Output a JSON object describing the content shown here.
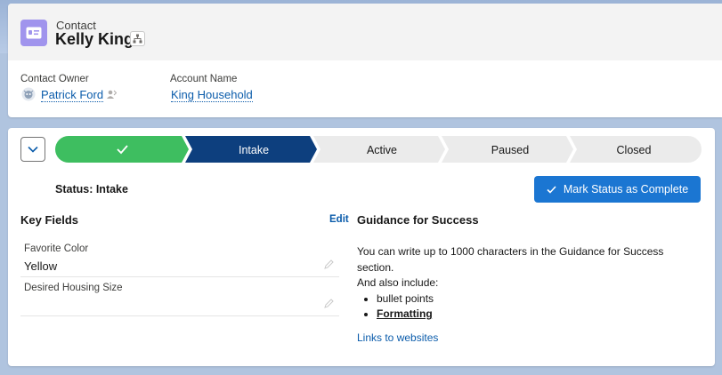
{
  "record": {
    "object_label": "Contact",
    "name": "Kelly King",
    "object_icon": "contact-card-icon",
    "accent_color": "#a094ed"
  },
  "highlights": {
    "owner_label": "Contact Owner",
    "owner_name": "Patrick Ford",
    "account_label": "Account Name",
    "account_name": "King Household"
  },
  "path": {
    "stages": [
      {
        "label": "",
        "state": "complete"
      },
      {
        "label": "Intake",
        "state": "current"
      },
      {
        "label": "Active",
        "state": "incomplete"
      },
      {
        "label": "Paused",
        "state": "incomplete"
      },
      {
        "label": "Closed",
        "state": "incomplete"
      }
    ],
    "colors": {
      "complete": "#3ebe60",
      "current": "#0d3f7e",
      "incomplete": "#ebebeb"
    },
    "status_text": "Status: Intake",
    "mark_button": "Mark Status as Complete"
  },
  "key_fields": {
    "title": "Key Fields",
    "edit": "Edit",
    "fields": [
      {
        "label": "Favorite Color",
        "value": "Yellow"
      },
      {
        "label": "Desired Housing Size",
        "value": ""
      }
    ]
  },
  "guidance": {
    "title": "Guidance for Success",
    "line1": "You can write up to 1000 characters in the Guidance for Success section.",
    "line2": "And also include:",
    "bullets": [
      "bullet points",
      "Formatting"
    ],
    "link": "Links to websites"
  }
}
